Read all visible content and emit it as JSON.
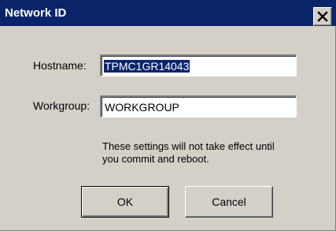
{
  "window": {
    "title": "Network ID",
    "close_icon": "close-icon"
  },
  "form": {
    "hostname_label": "Hostname:",
    "hostname_value": "TPMC1GR14043",
    "workgroup_label": "Workgroup:",
    "workgroup_value": "WORKGROUP"
  },
  "notice": {
    "line1": "These settings will not take effect until",
    "line2": "you commit and reboot."
  },
  "buttons": {
    "ok": "OK",
    "cancel": "Cancel"
  },
  "colors": {
    "titlebar": "#0a246a",
    "dialog_background": "#d4d0c8",
    "selection": "#0a246a"
  }
}
